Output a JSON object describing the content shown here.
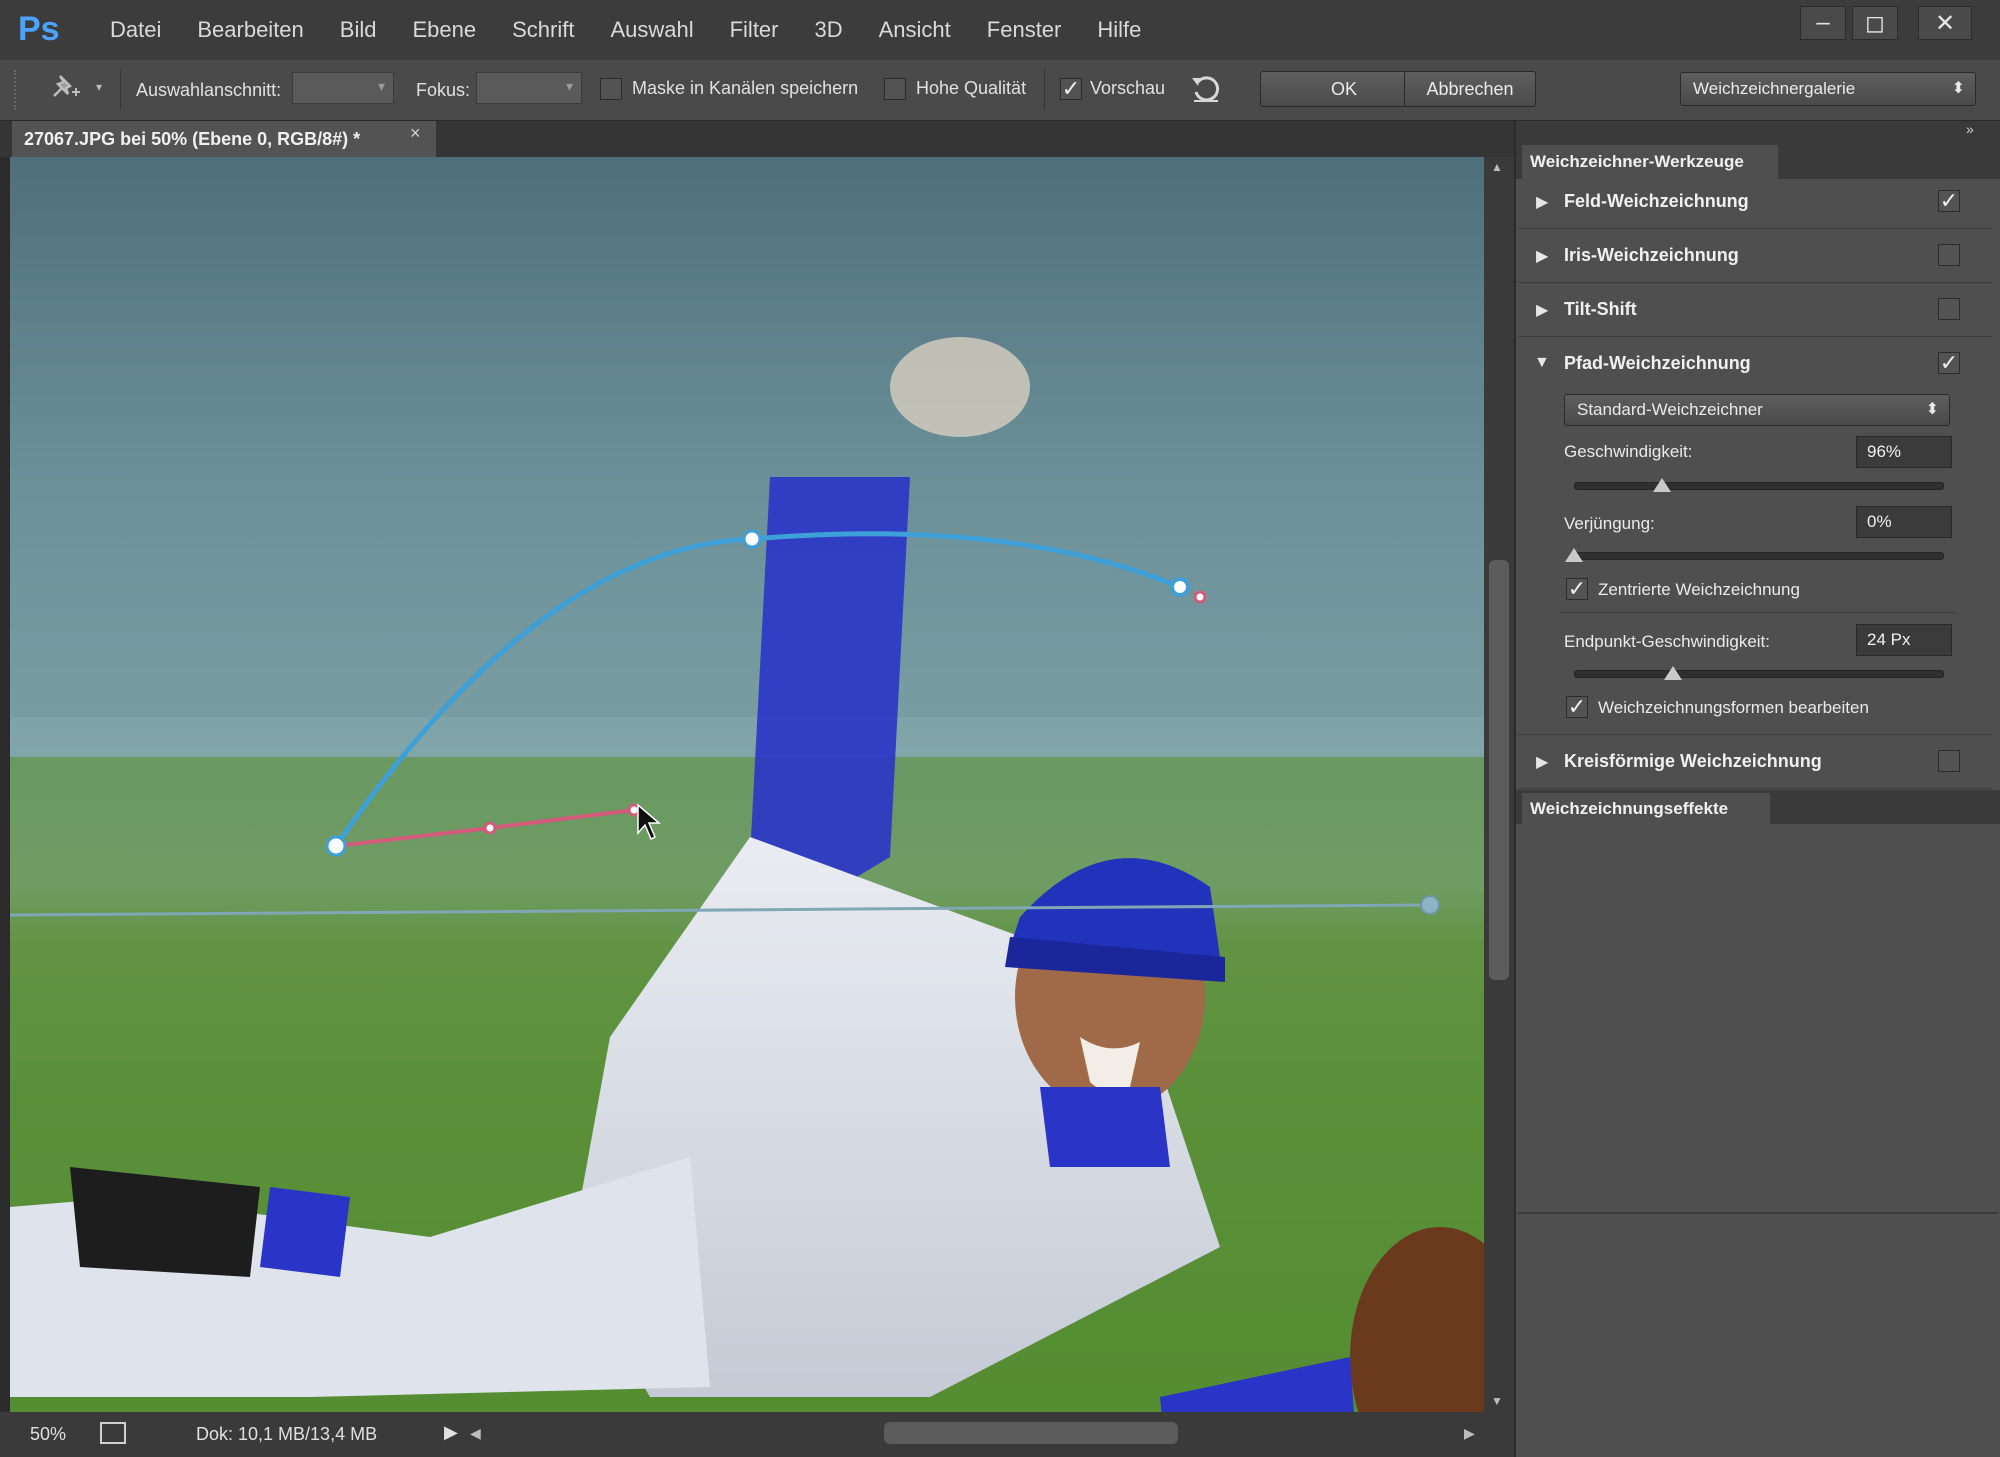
{
  "app": {
    "logo": "Ps"
  },
  "menu": [
    "Datei",
    "Bearbeiten",
    "Bild",
    "Ebene",
    "Schrift",
    "Auswahl",
    "Filter",
    "3D",
    "Ansicht",
    "Fenster",
    "Hilfe"
  ],
  "window_controls": {
    "minimize": "–",
    "maximize": "◻",
    "close": "✕"
  },
  "options": {
    "tool_icon": "pin-icon",
    "selection_label": "Auswahlanschnitt:",
    "focus_label": "Fokus:",
    "mask_label": "Maske in Kanälen speichern",
    "mask_checked": false,
    "quality_label": "Hohe Qualität",
    "quality_checked": false,
    "preview_label": "Vorschau",
    "preview_checked": true,
    "ok_label": "OK",
    "cancel_label": "Abbrechen",
    "workspace_select": "Weichzeichnergalerie"
  },
  "document": {
    "tab_title": "27067.JPG bei 50% (Ebene 0, RGB/8#) *",
    "close": "×"
  },
  "status": {
    "zoom": "50%",
    "doc_info": "Dok: 10,1 MB/13,4 MB"
  },
  "panel": {
    "tools_header": "Weichzeichner-Werkzeuge",
    "tools": [
      {
        "label": "Feld-Weichzeichnung",
        "expanded": false,
        "checked": true
      },
      {
        "label": "Iris-Weichzeichnung",
        "expanded": false,
        "checked": false
      },
      {
        "label": "Tilt-Shift",
        "expanded": false,
        "checked": false
      },
      {
        "label": "Pfad-Weichzeichnung",
        "expanded": true,
        "checked": true
      },
      {
        "label": "Kreisförmige Weichzeichnung",
        "expanded": false,
        "checked": false
      }
    ],
    "path_blur": {
      "mode_select": "Standard-Weichzeichner",
      "speed_label": "Geschwindigkeit:",
      "speed_value": "96%",
      "speed_fraction": 0.24,
      "taper_label": "Verjüngung:",
      "taper_value": "0%",
      "taper_fraction": 0.0,
      "centered_label": "Zentrierte Weichzeichnung",
      "centered_checked": true,
      "endpoint_label": "Endpunkt-Geschwindigkeit:",
      "endpoint_value": "24 Px",
      "endpoint_fraction": 0.27,
      "edit_shapes_label": "Weichzeichnungsformen bearbeiten",
      "edit_shapes_checked": true
    },
    "effects_header": "Weichzeichnungseffekte"
  }
}
